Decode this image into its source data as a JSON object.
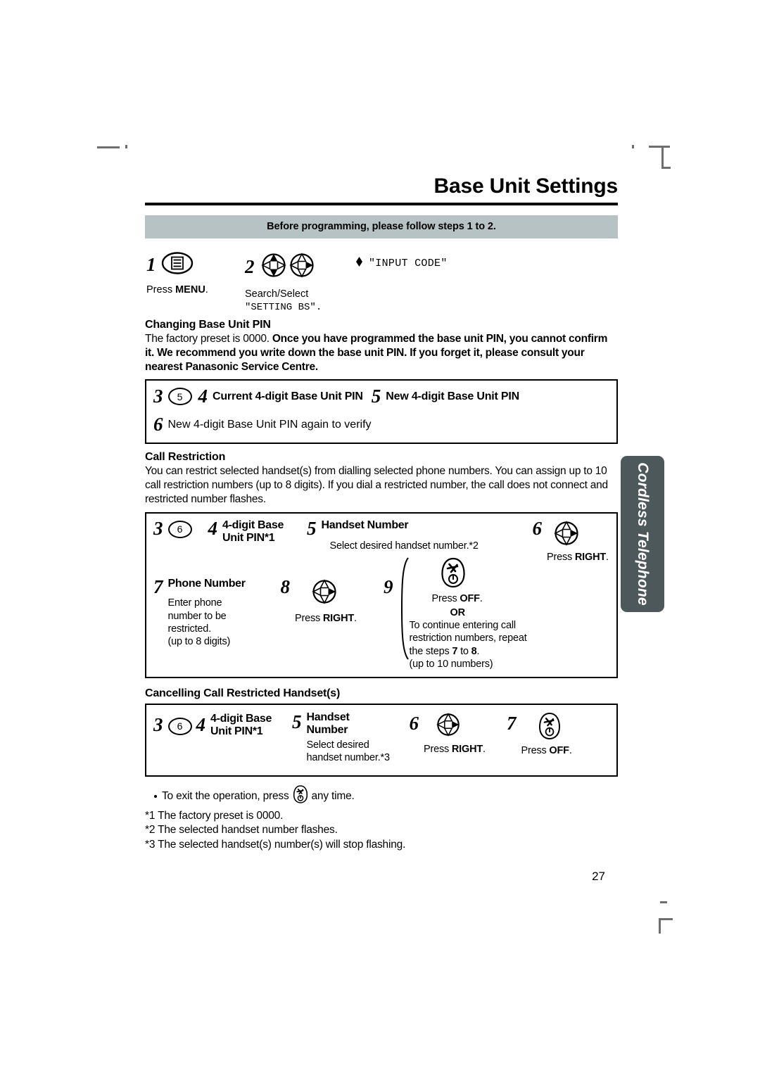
{
  "page": {
    "title": "Base Unit Settings",
    "number": "27",
    "side_tab": "Cordless Telephone",
    "banner": "Before programming, please follow steps 1 to 2."
  },
  "intro": {
    "step1": {
      "num": "1",
      "icon": "menu-button-icon",
      "label": "Press MENU.",
      "label_plain": "Press ",
      "label_bold": "MENU",
      "label_tail": "."
    },
    "step2": {
      "num": "2",
      "icon_search": "navigator-search-updown-icon",
      "icon_select": "navigator-select-right-icon",
      "label": "Search/Select",
      "label2": "\"SETTING BS\"."
    },
    "display": {
      "marker": "solid-arrow-marker",
      "code": "\"INPUT CODE\""
    }
  },
  "changing_pin": {
    "heading": "Changing Base Unit PIN",
    "body_plain": "The factory preset is 0000. ",
    "body_bold": "Once you have programmed the base unit PIN, you cannot confirm it. We recommend you write down the base unit PIN. If you forget it, please consult your nearest Panasonic Service Centre.",
    "steps": {
      "s3_num": "3",
      "s3_circled": "5",
      "s4_num": "4",
      "s4_text": "Current 4-digit Base Unit PIN",
      "s5_num": "5",
      "s5_text": "New 4-digit Base Unit PIN",
      "s6_num": "6",
      "s6_text": "New 4-digit Base Unit PIN again to verify"
    }
  },
  "call_restriction": {
    "heading": "Call Restriction",
    "body": "You can restrict selected handset(s) from dialling selected phone numbers. You can assign up to 10 call restriction numbers (up to 8 digits). If you dial a restricted number, the call does not connect and restricted number flashes.",
    "steps": {
      "s3_num": "3",
      "s3_circled": "6",
      "s4_num": "4",
      "s4_text_l1": "4-digit Base",
      "s4_text_l2": "Unit PIN*1",
      "s5_num": "5",
      "s5_text": "Handset Number",
      "s5_sub": "Select desired handset number.*2",
      "s6_num": "6",
      "s6_icon": "navigator-right-icon",
      "s6_sub_plain": "Press ",
      "s6_sub_bold": "RIGHT",
      "s6_sub_tail": ".",
      "s7_num": "7",
      "s7_text": "Phone Number",
      "s7_sub_l1": "Enter phone",
      "s7_sub_l2": "number to be",
      "s7_sub_l3": "restricted.",
      "s7_sub_l4": "(up to 8 digits)",
      "s8_num": "8",
      "s8_icon": "navigator-right-icon",
      "s8_sub_plain": "Press ",
      "s8_sub_bold": "RIGHT",
      "s8_sub_tail": ".",
      "s9_num": "9",
      "s9_icon": "power-off-handset-icon",
      "s9_press_plain": "Press ",
      "s9_press_bold": "OFF",
      "s9_press_tail": ".",
      "s9_or": "OR",
      "s9_cont_l1": "To continue entering call",
      "s9_cont_l2": "restriction numbers, repeat",
      "s9_cont_l3_a": "the steps ",
      "s9_cont_l3_b": "7",
      "s9_cont_l3_c": " to ",
      "s9_cont_l3_d": "8",
      "s9_cont_l3_e": ".",
      "s9_cont_l4": "(up to 10 numbers)"
    }
  },
  "cancelling": {
    "heading": "Cancelling Call Restricted Handset(s)",
    "steps": {
      "s3_num": "3",
      "s3_circled": "6",
      "s4_num": "4",
      "s4_text_l1": "4-digit Base",
      "s4_text_l2": "Unit PIN*1",
      "s5_num": "5",
      "s5_text_l1": "Handset",
      "s5_text_l2": "Number",
      "s5_sub_l1": "Select desired",
      "s5_sub_l2": "handset number.*3",
      "s6_num": "6",
      "s6_icon": "navigator-right-icon",
      "s6_sub_plain": "Press ",
      "s6_sub_bold": "RIGHT",
      "s6_sub_tail": ".",
      "s7_num": "7",
      "s7_icon": "power-off-handset-icon",
      "s7_sub_plain": "Press ",
      "s7_sub_bold": "OFF",
      "s7_sub_tail": "."
    }
  },
  "notes": {
    "exit_a": "To exit the operation, press ",
    "exit_icon": "power-off-handset-icon",
    "exit_b": " any time.",
    "n1": "*1 The factory preset is 0000.",
    "n2": "*2 The selected handset number flashes.",
    "n3": "*3 The selected handset(s) number(s) will stop flashing."
  },
  "colors": {
    "banner_bg": "#b6c2c3",
    "side_tab_bg": "#4d585a",
    "text": "#000000"
  }
}
